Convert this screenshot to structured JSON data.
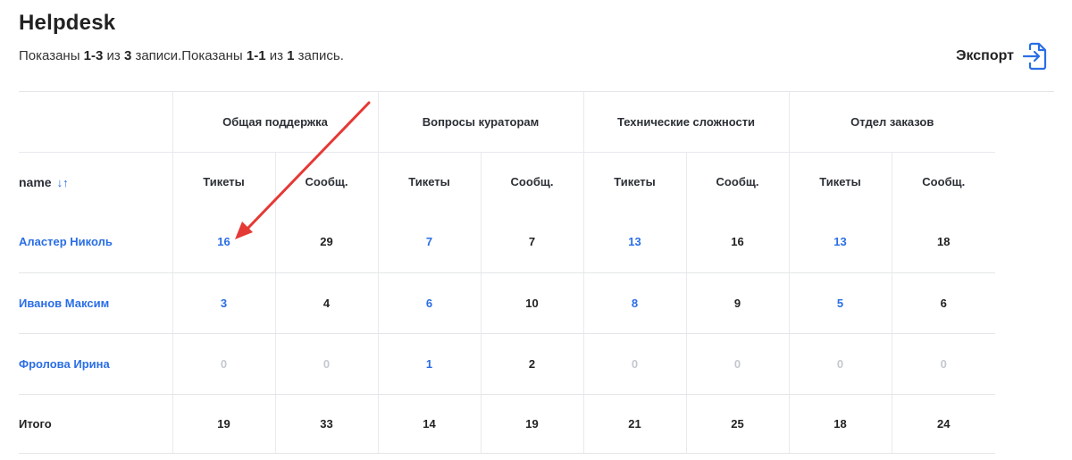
{
  "page": {
    "title": "Helpdesk",
    "summary": {
      "p1": "Показаны ",
      "r1": "1-3",
      "p2": " из ",
      "t1": "3",
      "p3": " записи.Показаны ",
      "r2": "1-1",
      "p4": " из ",
      "t2": "1",
      "p5": " запись."
    },
    "export_label": "Экспорт"
  },
  "table": {
    "name_header": "name",
    "sort_glyph": "↓↑",
    "groups": [
      "Общая поддержка",
      "Вопросы кураторам",
      "Технические сложности",
      "Отдел заказов"
    ],
    "subheaders": [
      "Тикеты",
      "Сообщ.",
      "Тикеты",
      "Сообщ.",
      "Тикеты",
      "Сообщ.",
      "Тикеты",
      "Сообщ."
    ],
    "rows": [
      {
        "name": "Аластер Николь",
        "values": [
          "16",
          "29",
          "7",
          "7",
          "13",
          "16",
          "13",
          "18"
        ]
      },
      {
        "name": "Иванов Максим",
        "values": [
          "3",
          "4",
          "6",
          "10",
          "8",
          "9",
          "5",
          "6"
        ]
      },
      {
        "name": "Фролова Ирина",
        "values": [
          "0",
          "0",
          "1",
          "2",
          "0",
          "0",
          "0",
          "0"
        ]
      }
    ],
    "total": {
      "label": "Итого",
      "values": [
        "19",
        "33",
        "14",
        "19",
        "21",
        "25",
        "18",
        "24"
      ]
    }
  },
  "colors": {
    "link": "#2a6ee6",
    "muted": "#c5c9cf",
    "annotation_arrow": "#e53935"
  },
  "icons": {
    "export": "export-file-arrow-icon",
    "sort": "sort-arrows-icon"
  }
}
